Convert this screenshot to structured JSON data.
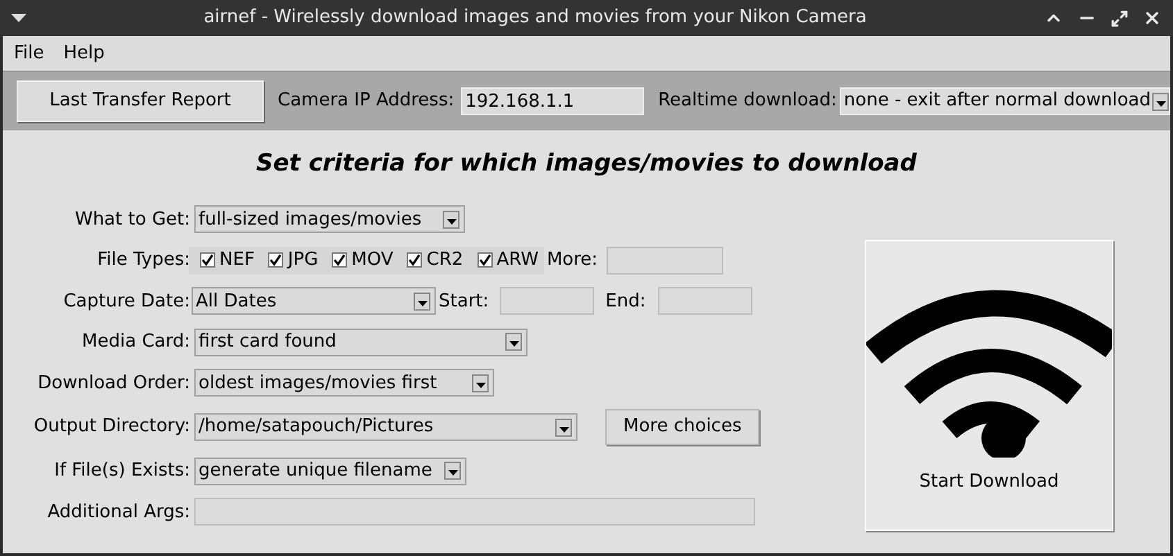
{
  "window": {
    "title": "airnef - Wirelessly download images and movies from your Nikon Camera"
  },
  "menu": [
    "File",
    "Help"
  ],
  "toolbar": {
    "report_button": "Last Transfer Report",
    "ip_label": "Camera IP Address:",
    "ip_value": "192.168.1.1",
    "realtime_label": "Realtime download:",
    "realtime_value": "none - exit after normal download"
  },
  "heading": "Set criteria for which images/movies to download",
  "rows": [
    {
      "kind": "dropdown",
      "label": "What to Get:",
      "value": "full-sized images/movies"
    },
    {
      "kind": "checkboxes",
      "label": "File Types:",
      "options": [
        {
          "label": "NEF",
          "checked": true
        },
        {
          "label": "JPG",
          "checked": true
        },
        {
          "label": "MOV",
          "checked": true
        },
        {
          "label": "CR2",
          "checked": true
        },
        {
          "label": "ARW",
          "checked": true
        }
      ],
      "more_label": "More:"
    },
    {
      "kind": "date",
      "label": "Capture Date:",
      "value": "All Dates",
      "start_label": "Start:",
      "end_label": "End:"
    },
    {
      "kind": "dropdown",
      "label": "Media Card:",
      "value": "first card found"
    },
    {
      "kind": "dropdown",
      "label": "Download Order:",
      "value": "oldest images/movies first"
    },
    {
      "kind": "dropdown",
      "label": "Output Directory:",
      "value": "/home/satapouch/Pictures",
      "button": "More choices"
    },
    {
      "kind": "dropdown",
      "label": "If File(s) Exists:",
      "value": "generate unique filename"
    },
    {
      "kind": "text",
      "label": "Additional Args:"
    }
  ],
  "start_button": "Start Download"
}
